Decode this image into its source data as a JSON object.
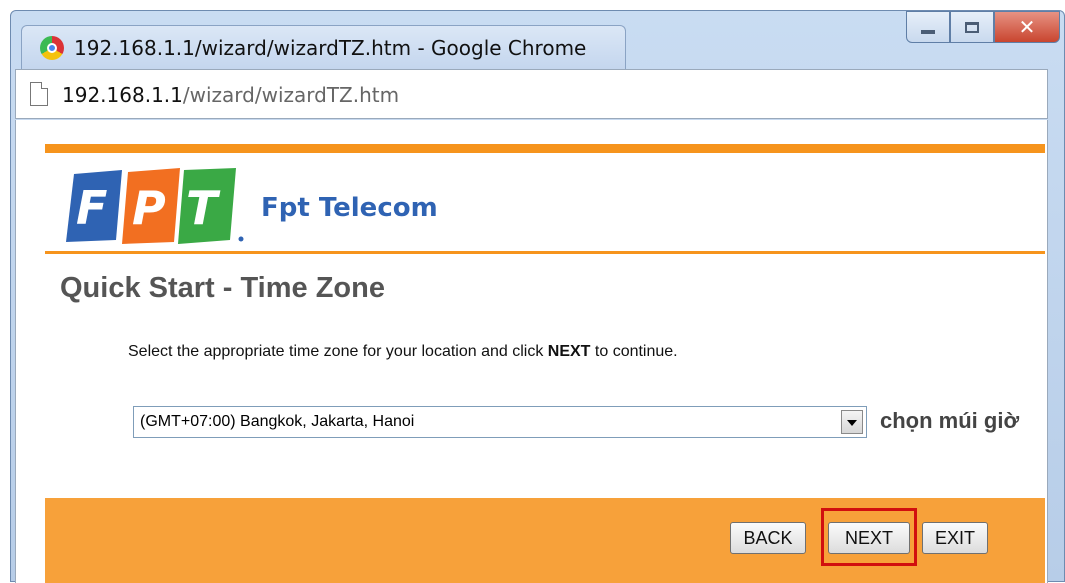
{
  "window": {
    "title": "192.168.1.1/wizard/wizardTZ.htm - Google Chrome"
  },
  "address_bar": {
    "host": "192.168.1.1",
    "path": "/wizard/wizardTZ.htm"
  },
  "header": {
    "logo_text": "FPT",
    "brand_name": "Fpt Telecom"
  },
  "page": {
    "title": "Quick Start - Time Zone",
    "instruction_prefix": "Select the appropriate time zone for your location and click ",
    "instruction_bold": "NEXT",
    "instruction_suffix": " to continue.",
    "timezone_selected": "(GMT+07:00) Bangkok, Jakarta, Hanoi",
    "side_note": "chọn múi giờ"
  },
  "buttons": {
    "back": "BACK",
    "next": "NEXT",
    "exit": "EXIT"
  },
  "colors": {
    "accent_orange": "#f6941d",
    "footer_orange": "#f7a13a",
    "brand_blue": "#2f63b3",
    "highlight_red": "#d10f0f"
  }
}
